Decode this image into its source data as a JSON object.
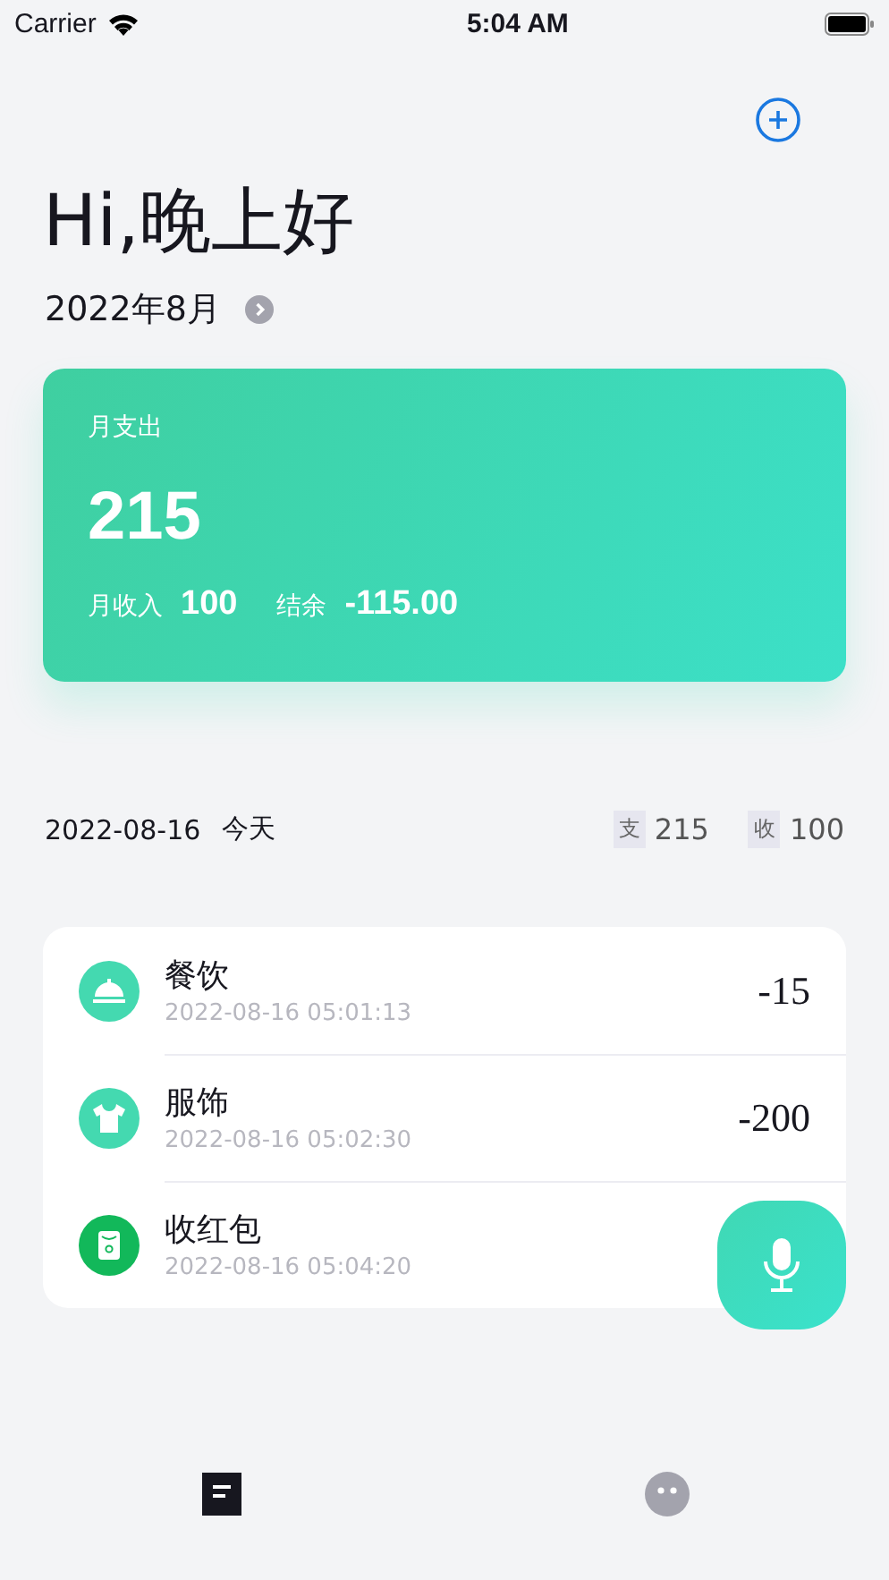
{
  "status_bar": {
    "carrier": "Carrier",
    "time": "5:04 AM"
  },
  "greeting": "Hi,晚上好",
  "month": "2022年8月",
  "summary": {
    "label": "月支出",
    "expense": "215",
    "income_label": "月收入",
    "income": "100",
    "balance_label": "结余",
    "balance": "-115.00"
  },
  "day": {
    "date": "2022-08-16",
    "label": "今天",
    "expense_tag": "支",
    "expense": "215",
    "income_tag": "收",
    "income": "100"
  },
  "transactions": [
    {
      "kind": "food",
      "color": "#44d9b0",
      "name": "餐饮",
      "time": "2022-08-16 05:01:13",
      "amount": "-15"
    },
    {
      "kind": "clothing",
      "color": "#44d9b0",
      "name": "服饰",
      "time": "2022-08-16 05:02:30",
      "amount": "-200"
    },
    {
      "kind": "redpacket",
      "color": "#12b85a",
      "name": "收红包",
      "time": "2022-08-16 05:04:20"
    }
  ],
  "tabs": [
    {
      "kind": "records",
      "selected": true
    },
    {
      "kind": "profile",
      "selected": false
    }
  ]
}
